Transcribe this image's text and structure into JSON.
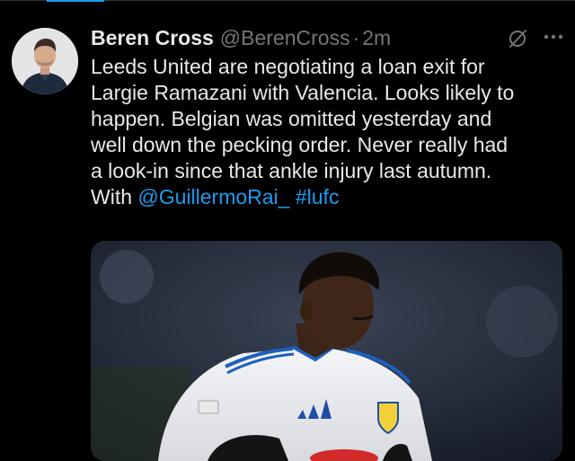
{
  "tweet": {
    "author_name": "Beren Cross",
    "author_handle": "@BerenCross",
    "separator": "·",
    "time": "2m",
    "text_lines": [
      "Leeds United are negotiating a loan exit for",
      "Largie Ramazani with Valencia. Looks likely to",
      "happen. Belgian was omitted yesterday and",
      "well down the pecking order. Never really had",
      "a look-in since that ankle injury last autumn."
    ],
    "last_line_prefix": "With ",
    "mention": "@GuillermoRai_",
    "hashtag": "#lufc",
    "icons": {
      "grok": "grok-icon",
      "more": "more-icon"
    }
  },
  "colors": {
    "background": "#000000",
    "text": "#e7e9ea",
    "muted": "#71767b",
    "link": "#1d9bf0"
  }
}
